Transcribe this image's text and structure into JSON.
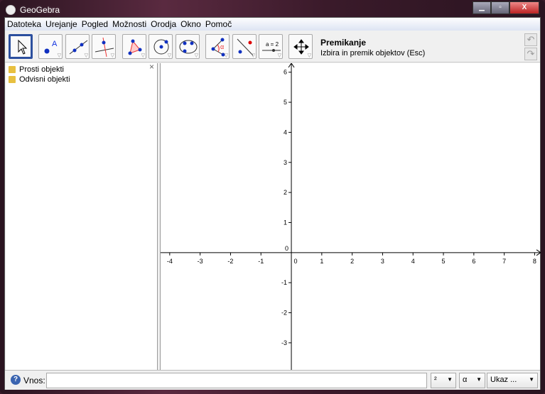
{
  "window": {
    "title": "GeoGebra"
  },
  "menu": [
    "Datoteka",
    "Urejanje",
    "Pogled",
    "Možnosti",
    "Orodja",
    "Okno",
    "Pomoč"
  ],
  "toolbar": {
    "tools": [
      "move",
      "point",
      "line",
      "perpendicular",
      "polygon",
      "circle",
      "conic",
      "angle",
      "reflect",
      "slider",
      "move-view"
    ],
    "slider_label": "a = 2",
    "help_title": "Premikanje",
    "help_text": "Izbira in premik objektov (Esc)"
  },
  "algebra": {
    "folders": [
      "Prosti objekti",
      "Odvisni objekti"
    ],
    "close": "×"
  },
  "graphics": {
    "x_ticks": [
      -4,
      -3,
      -2,
      -1,
      0,
      1,
      2,
      3,
      4,
      5,
      6,
      7,
      8
    ],
    "y_ticks": [
      -3,
      -2,
      -1,
      0,
      1,
      2,
      3,
      4,
      5,
      6
    ],
    "xlim": [
      -4.3,
      8.2
    ],
    "ylim": [
      -3.9,
      6.3
    ]
  },
  "inputbar": {
    "label": "Vnos:",
    "value": "",
    "sup": "²",
    "greek": "α",
    "commands": "Ukaz ..."
  }
}
